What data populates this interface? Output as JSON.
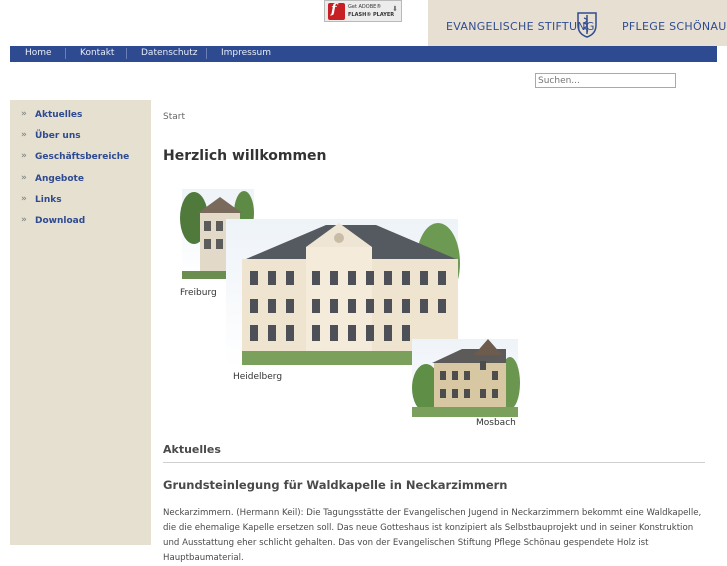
{
  "flash_badge": {
    "line1": "Get ADOBE®",
    "line2": "FLASH® PLAYER"
  },
  "brand": {
    "left": "EVANGELISCHE STIFTUNG",
    "right": "PFLEGE SCHÖNAU",
    "emblem_icon": "staff-of-asclepius-icon"
  },
  "nav": {
    "items": [
      "Home",
      "Kontakt",
      "Datenschutz",
      "Impressum"
    ]
  },
  "search": {
    "placeholder": "Suchen..."
  },
  "sidebar": {
    "items": [
      {
        "label": "Aktuelles"
      },
      {
        "label": "Über uns"
      },
      {
        "label": "Geschäftsbereiche"
      },
      {
        "label": "Angebote"
      },
      {
        "label": "Links"
      },
      {
        "label": "Download"
      }
    ]
  },
  "main": {
    "breadcrumb": "Start",
    "title": "Herzlich willkommen",
    "collage": {
      "captions": [
        "Freiburg",
        "Heidelberg",
        "Mosbach"
      ]
    },
    "section_title": "Aktuelles",
    "news": {
      "title": "Grundsteinlegung für Waldkapelle in Neckarzimmern",
      "body": "Neckarzimmern. (Hermann Keil): Die Tagungsstätte der Evangelischen Jugend in Neckarzimmern bekommt eine Waldkapelle, die die ehemalige Kapelle ersetzen soll. Das neue Gotteshaus ist konzipiert als Selbstbauprojekt und in seiner Konstruktion und Ausstattung eher schlicht gehalten. Das von der Evangelischen Stiftung Pflege Schönau gespendete Holz ist Hauptbaumaterial."
    }
  },
  "colors": {
    "nav_bg": "#2e4a91",
    "sidebar_bg": "#e5e0d0",
    "brand_bg": "#e7dfd2",
    "link": "#2e4a91"
  }
}
